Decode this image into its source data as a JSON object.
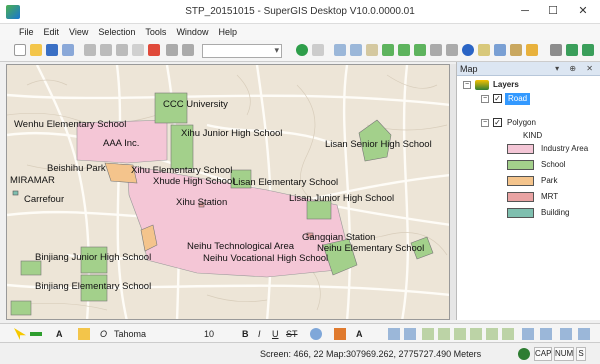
{
  "window": {
    "title": "STP_20151015 - SuperGIS Desktop V10.0.0000.01",
    "minimize": "─",
    "maximize": "☐",
    "close": "✕"
  },
  "menu": [
    "File",
    "Edit",
    "View",
    "Selection",
    "Tools",
    "Window",
    "Help"
  ],
  "map_panel": {
    "title": "Map",
    "controls": "▾ ⊕ ✕",
    "root": "Layers",
    "road_layer": "Road",
    "polygon_layer": "Polygon",
    "field": "KIND",
    "legend": [
      {
        "label": "Industry Area",
        "color": "#f4c6d6"
      },
      {
        "label": "School",
        "color": "#a3d08b"
      },
      {
        "label": "Park",
        "color": "#f4c48c"
      },
      {
        "label": "MRT",
        "color": "#e9a3a3"
      },
      {
        "label": "Building",
        "color": "#7fbfaf"
      }
    ]
  },
  "map_labels": [
    "CCC University",
    "Wenhu Elementary School",
    "AAA Inc.",
    "Xihu Junior High School",
    "Lisan Senior High School",
    "Beishihu Park",
    "Xihu Elementary School",
    "Xhude High School",
    "Lisan Elementary School",
    "MIRAMAR",
    "Carrefour",
    "Xihu Station",
    "Lisan Junior High School",
    "Gangqian Station",
    "Neihu Elementary School",
    "Neihu Technological Area",
    "Neihu Vocational High School",
    "Binjiang Junior High School",
    "Binjiang Elementary School"
  ],
  "text_toolbar": {
    "font_name": "Tahoma",
    "font_size": "10",
    "bold": "B",
    "italic": "I",
    "underline": "U",
    "strike": "ST"
  },
  "status": {
    "screen": "Screen: 466, 22",
    "map": "Map:307969.262, 2775727.490 Meters",
    "cap": "CAP",
    "num": "NUM",
    "scrl": "S"
  }
}
